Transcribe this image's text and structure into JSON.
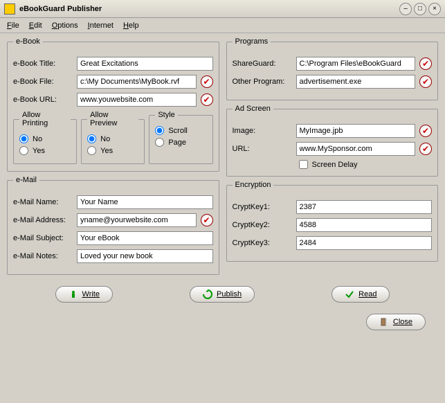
{
  "window": {
    "title": "eBookGuard Publisher"
  },
  "menu": {
    "file": "File",
    "edit": "Edit",
    "options": "Options",
    "internet": "Internet",
    "help": "Help"
  },
  "ebook": {
    "legend": "e-Book",
    "title_label": "e-Book Title:",
    "title_value": "Great Excitations",
    "file_label": "e-Book File:",
    "file_value": "c:\\My Documents\\MyBook.rvf",
    "url_label": "e-Book URL:",
    "url_value": "www.youwebsite.com",
    "allow_printing": {
      "legend": "Allow Printing",
      "no": "No",
      "yes": "Yes"
    },
    "allow_preview": {
      "legend": "Allow Preview",
      "no": "No",
      "yes": "Yes"
    },
    "style": {
      "legend": "Style",
      "scroll": "Scroll",
      "page": "Page"
    }
  },
  "email": {
    "legend": "e-Mail",
    "name_label": "e-Mail Name:",
    "name_value": "Your Name",
    "addr_label": "e-Mail Address:",
    "addr_value": "yname@yourwebsite.com",
    "subj_label": "e-Mail Subject:",
    "subj_value": "Your eBook",
    "notes_label": "e-Mail Notes:",
    "notes_value": "Loved your new book"
  },
  "programs": {
    "legend": "Programs",
    "sg_label": "ShareGuard:",
    "sg_value": "C:\\Program Files\\eBookGuard",
    "other_label": "Other Program:",
    "other_value": "advertisement.exe"
  },
  "adscreen": {
    "legend": "Ad Screen",
    "image_label": "Image:",
    "image_value": "MyImage.jpb",
    "url_label": "URL:",
    "url_value": "www.MySponsor.com",
    "delay_label": "Screen Delay"
  },
  "encryption": {
    "legend": "Encryption",
    "k1_label": "CryptKey1:",
    "k1_value": "2387",
    "k2_label": "CryptKey2:",
    "k2_value": "4588",
    "k3_label": "CryptKey3:",
    "k3_value": "2484"
  },
  "buttons": {
    "write": "Write",
    "publish": "Publish",
    "read": "Read",
    "close": "Close"
  }
}
